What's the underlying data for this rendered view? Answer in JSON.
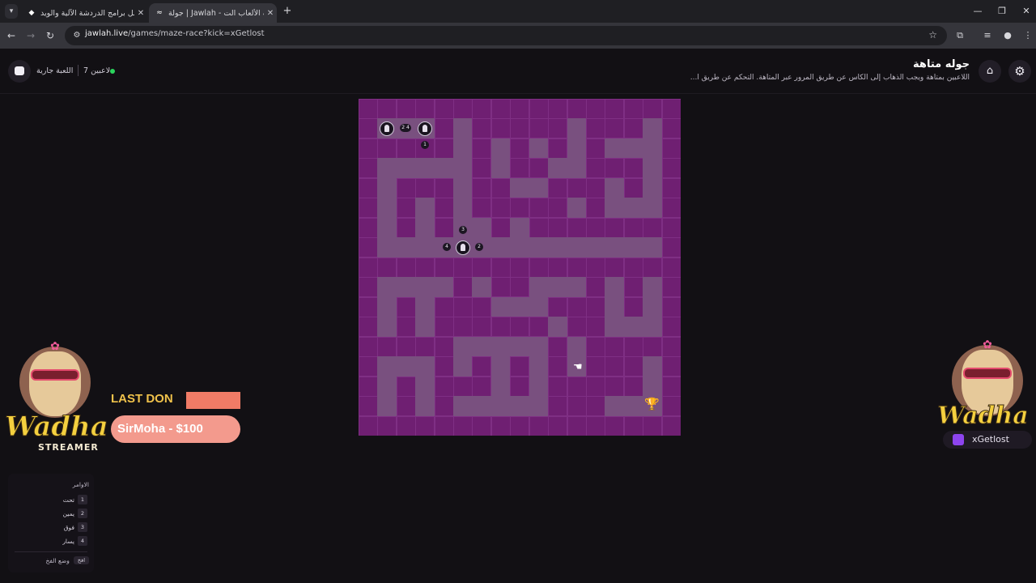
{
  "browser": {
    "tabs": [
      {
        "title": "أفضل برامج الدردشة الآلية والويد...",
        "active": false
      },
      {
        "title": "جولة | Jawlah - منصة الألعاب الت...",
        "active": true
      }
    ],
    "url_host": "jawlah.live",
    "url_path": "/games/maze-race?kick=xGetlost"
  },
  "header": {
    "status": "اللعبة جارية",
    "players": "7 لاعبين",
    "title": "جوله متاهة",
    "description": "اللاعبين بمتاهة ويجب الذهاب إلى الكأس عن طريق المرور عبر المتاهة. التحكم عن طريق ا..."
  },
  "maze": {
    "cols": 17,
    "rows": 17,
    "grid": [
      "11111111111111111",
      "10001011111011101",
      "11111010101010001",
      "10000010110011101",
      "10111011001110101",
      "10101011111010001",
      "10101001011111111",
      "10000000000000001",
      "11111111111111111",
      "10000101100010101",
      "10101110001110101",
      "10101111110110001",
      "11111000001011111",
      "10001010101011101",
      "10101110101111101",
      "10101000001110001",
      "11111111111111111"
    ],
    "players": [
      {
        "cell": [
          1,
          1
        ],
        "label": "player-1"
      },
      {
        "cell": [
          3,
          1
        ],
        "label": "player-2"
      },
      {
        "cell": [
          5,
          7
        ],
        "label": "player-3"
      }
    ],
    "tags": [
      {
        "text": "2 4"
      },
      {
        "text": "1"
      },
      {
        "text": "3"
      },
      {
        "text": "4"
      },
      {
        "text": "2"
      }
    ],
    "trophy_icon": "trophy-icon"
  },
  "overlay": {
    "last_donation_label": "LAST DON",
    "donor": "SirMoha - $100",
    "brand_left": "Wadha",
    "streamer_label": "STREAMER",
    "brand_right": "Wadha",
    "handle": "xGetlost"
  },
  "commands": {
    "title": "الاوامر",
    "items": [
      {
        "key": "1",
        "label": "تحت"
      },
      {
        "key": "2",
        "label": "يمين"
      },
      {
        "key": "3",
        "label": "فوق"
      },
      {
        "key": "4",
        "label": "يسار"
      }
    ],
    "trap_label": "وضع الفخ",
    "trap_key": "افخ"
  },
  "colors": {
    "wall": "#6f1f72",
    "path": "#79507f",
    "accent_green": "#2bd45d"
  }
}
